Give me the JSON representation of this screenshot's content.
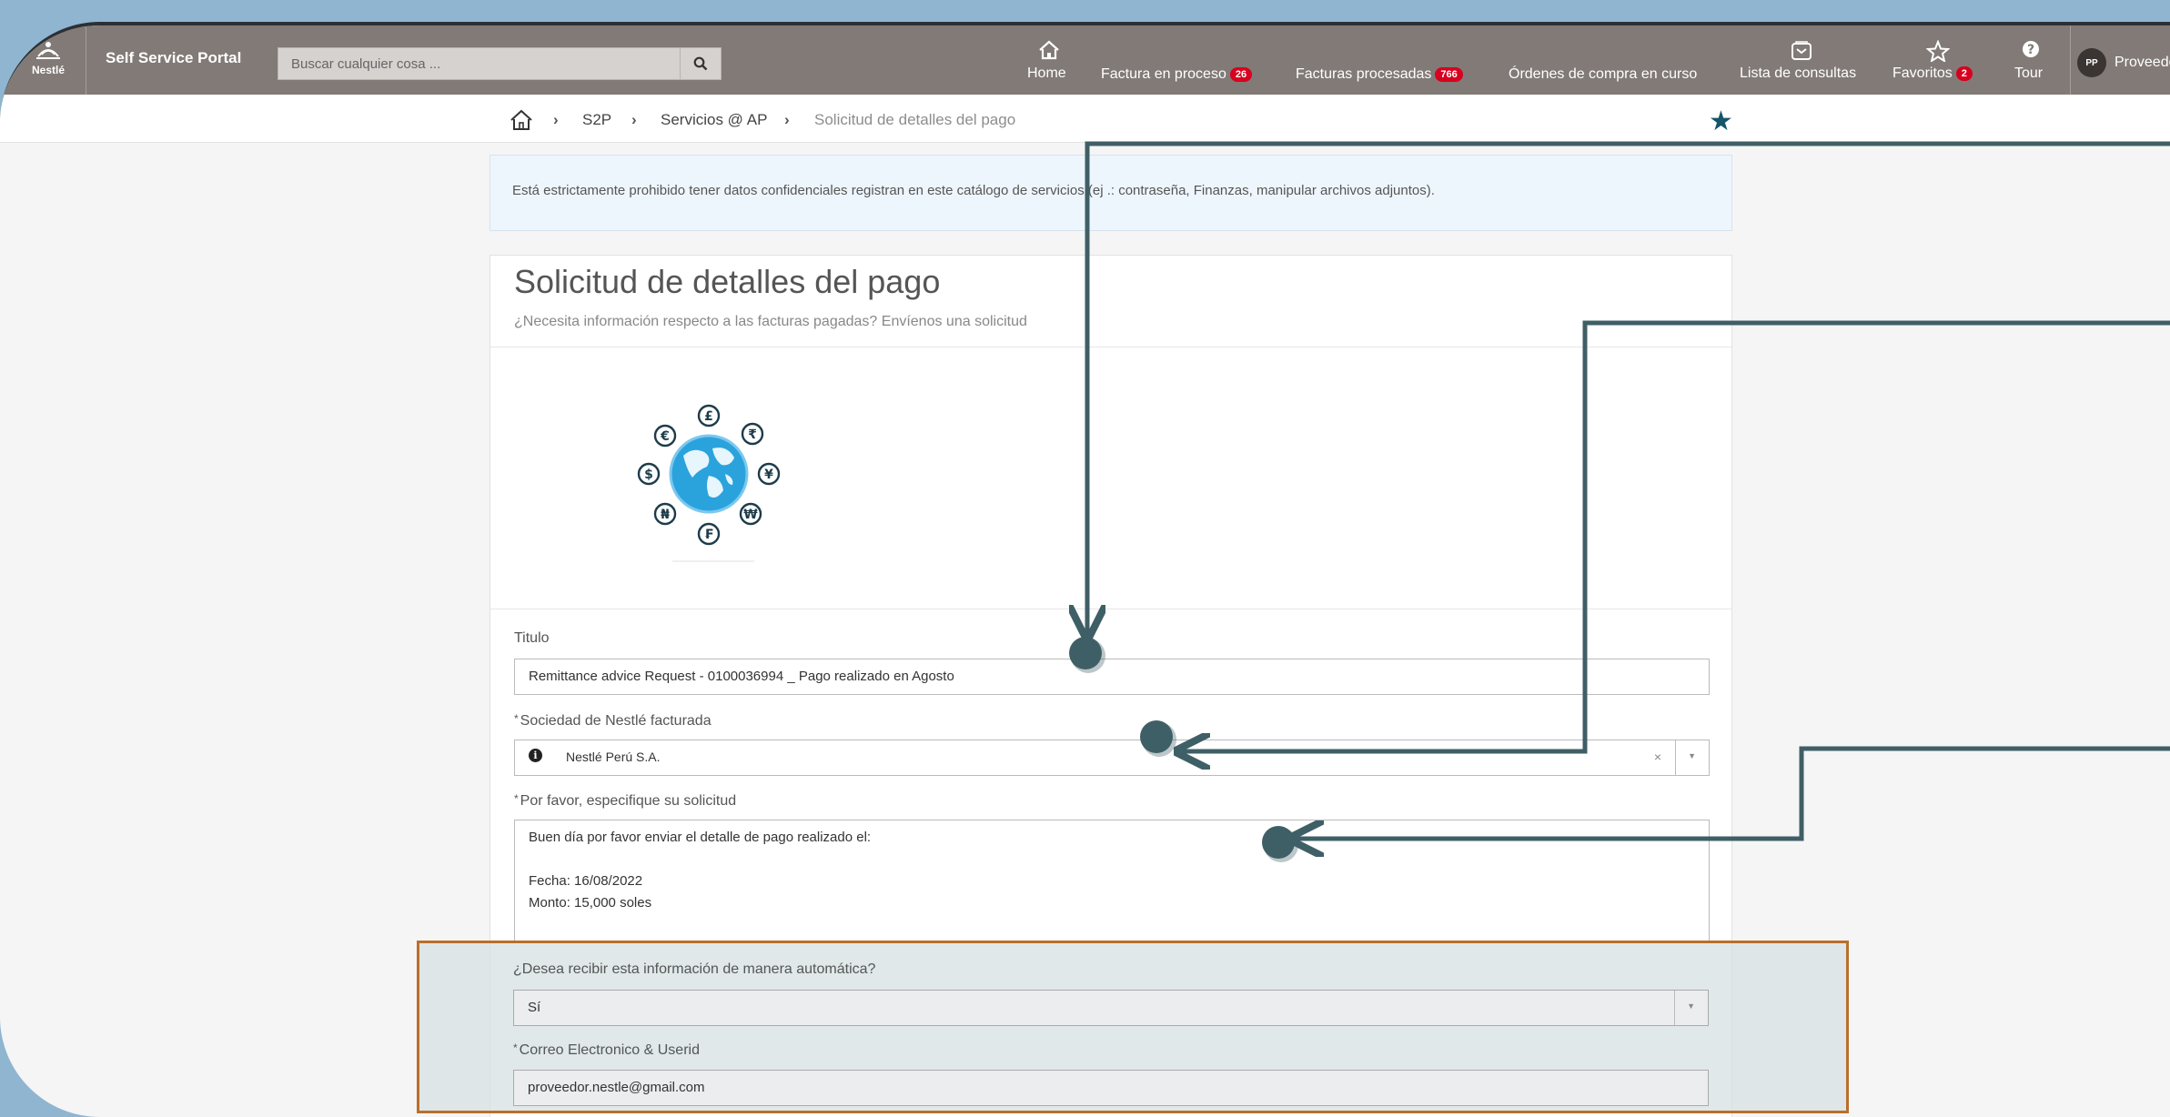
{
  "topbar": {
    "logo_text": "Nestlé",
    "brand": "Self Service Portal",
    "search_placeholder": "Buscar cualquier cosa ...",
    "nav": [
      {
        "label": "Home",
        "icon": "home-icon"
      },
      {
        "label": "Factura en proceso",
        "badge": "26"
      },
      {
        "label": "Facturas procesadas",
        "badge": "766"
      },
      {
        "label": "Órdenes de compra en curso"
      },
      {
        "label": "Lista de consultas",
        "icon": "inbox-icon"
      },
      {
        "label": "Favoritos",
        "icon": "star-outline-icon",
        "badge": "2"
      },
      {
        "label": "Tour",
        "icon": "help-icon"
      }
    ],
    "avatar_initials": "PP",
    "user_name": "Proveedor"
  },
  "breadcrumb": {
    "items": [
      "S2P",
      "Servicios @ AP",
      "Solicitud de detalles del pago"
    ]
  },
  "alert_text": "Está estrictamente prohibido tener datos confidenciales registran en este catálogo de servicios (ej .: contraseña, Finanzas, manipular archivos adjuntos).",
  "form": {
    "title": "Solicitud de detalles del pago",
    "subtitle": "¿Necesita información respecto a las facturas pagadas? Envíenos una solicitud",
    "currency_symbols": [
      "£",
      "₹",
      "€",
      "¥",
      "$",
      "₦",
      "₩",
      "₣"
    ],
    "titulo_label": "Titulo",
    "titulo_value": "Remittance advice Request - 0100036994 _ Pago realizado en Agosto",
    "sociedad_label": "Sociedad de Nestlé facturada",
    "sociedad_value": "Nestlé Perú S.A.",
    "clear_symbol": "×",
    "dropdown_symbol": "▼",
    "solicitud_label": "Por favor, especifique su solicitud",
    "solicitud_lines": [
      "Buen día por favor enviar el detalle de pago realizado el:",
      "",
      "Fecha: 16/08/2022",
      "Monto:  15,000 soles"
    ],
    "automatica_label": "¿Desea recibir esta información de manera automática?",
    "automatica_value": "Sí",
    "correo_label": "Correo Electronico & Userid",
    "correo_value": "proveedor.nestle@gmail.com",
    "required_mark": "*"
  },
  "colors": {
    "topbar": "#817a76",
    "badge": "#d8001f",
    "annotation": "#3f5f66",
    "highlight_border": "#b96f2b",
    "favorite_star": "#16546a"
  }
}
